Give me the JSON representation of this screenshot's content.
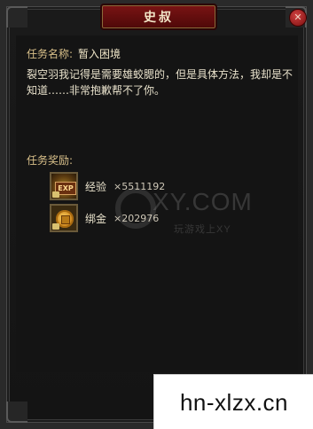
{
  "window": {
    "title": "史叔"
  },
  "close_icon": "✕",
  "task": {
    "name_label": "任务名称:",
    "name_value": "暂入困境",
    "description": "裂空羽我记得是需要雄蛟腮的，但是具体方法，我却是不知道……非常抱歉帮不了你。"
  },
  "rewards": {
    "label": "任务奖励:",
    "items": [
      {
        "icon": "exp-icon",
        "badge": "EXP",
        "name": "经验",
        "count": "×5511192"
      },
      {
        "icon": "gold-coin-icon",
        "name": "绑金",
        "count": "×202976"
      }
    ]
  },
  "watermark": {
    "logo_text": "XY.COM",
    "tagline": "玩游戏上XY"
  },
  "footer": {
    "site": "hn-xlzx.cn"
  }
}
